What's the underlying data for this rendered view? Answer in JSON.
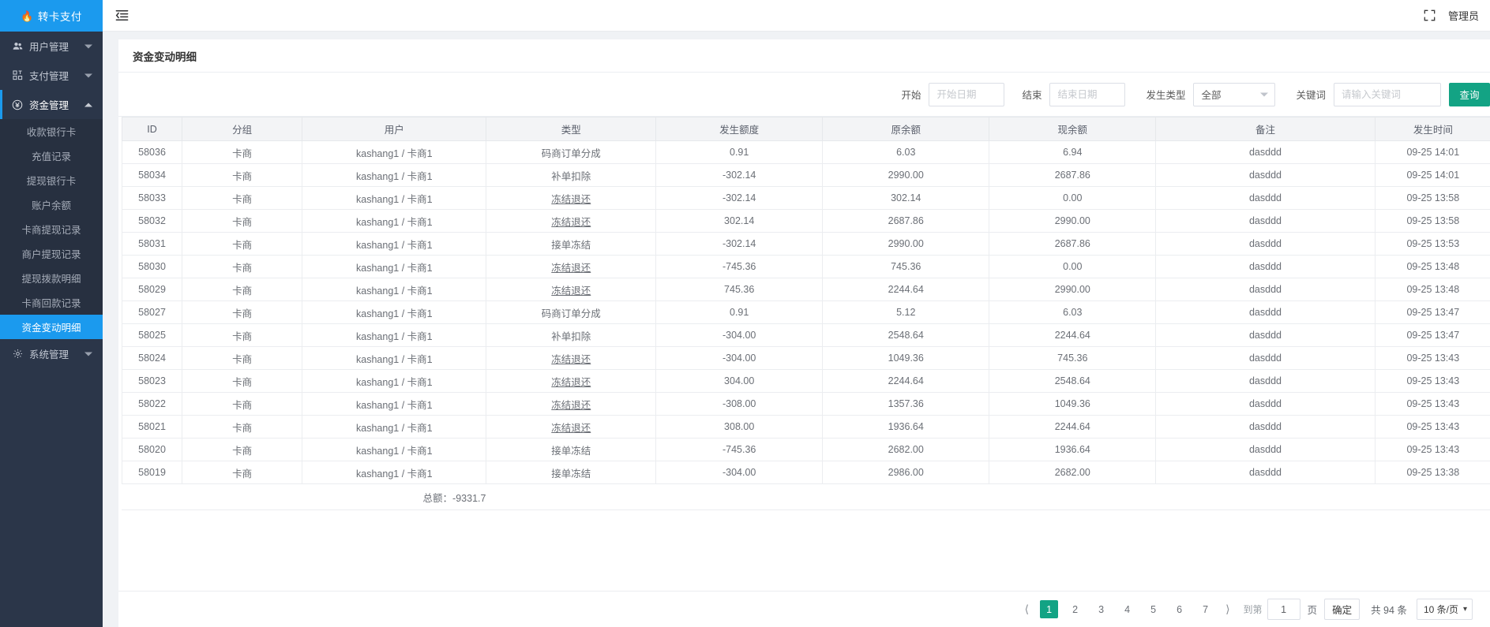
{
  "sidebar": {
    "brand": {
      "label": "转卡支付",
      "icon": "flame-icon",
      "bg": "#1b9aee"
    },
    "groups": [
      {
        "label": "用户管理",
        "icon": "users-icon",
        "expanded": false
      },
      {
        "label": "支付管理",
        "icon": "apps-icon",
        "expanded": false
      },
      {
        "label": "资金管理",
        "icon": "yen-circle-icon",
        "expanded": true
      },
      {
        "label": "系统管理",
        "icon": "gear-icon",
        "expanded": false
      }
    ],
    "fund_submenu": [
      {
        "label": "收款银行卡",
        "selected": false
      },
      {
        "label": "充值记录",
        "selected": false
      },
      {
        "label": "提现银行卡",
        "selected": false
      },
      {
        "label": "账户余额",
        "selected": false
      },
      {
        "label": "卡商提现记录",
        "selected": false
      },
      {
        "label": "商户提现记录",
        "selected": false
      },
      {
        "label": "提现拨款明细",
        "selected": false
      },
      {
        "label": "卡商回款记录",
        "selected": false
      },
      {
        "label": "资金变动明细",
        "selected": true
      }
    ]
  },
  "topbar": {
    "collapse_icon": "menu-collapse-icon",
    "fullscreen_icon": "fullscreen-icon",
    "admin_label": "管理员"
  },
  "page": {
    "title": "资金变动明细"
  },
  "filters": {
    "start_label": "开始",
    "start_placeholder": "开始日期",
    "start_value": "",
    "end_label": "结束",
    "end_placeholder": "结束日期",
    "end_value": "",
    "type_label": "发生类型",
    "type_value": "全部",
    "keyword_label": "关键词",
    "keyword_placeholder": "请输入关键词",
    "keyword_value": "",
    "query_button": "查询",
    "query_color": "#13a384"
  },
  "table": {
    "columns": [
      "ID",
      "分组",
      "用户",
      "类型",
      "发生额度",
      "原余额",
      "现余额",
      "备注",
      "发生时间"
    ],
    "rows": [
      {
        "id": "58036",
        "group": "卡商",
        "user": "kashang1 / 卡商1",
        "type": "码商订单分成",
        "type_link": false,
        "amount": "0.91",
        "old_balance": "6.03",
        "new_balance": "6.94",
        "remark": "dasddd",
        "time": "09-25 14:01"
      },
      {
        "id": "58034",
        "group": "卡商",
        "user": "kashang1 / 卡商1",
        "type": "补单扣除",
        "type_link": false,
        "amount": "-302.14",
        "old_balance": "2990.00",
        "new_balance": "2687.86",
        "remark": "dasddd",
        "time": "09-25 14:01"
      },
      {
        "id": "58033",
        "group": "卡商",
        "user": "kashang1 / 卡商1",
        "type": "冻结退还",
        "type_link": true,
        "amount": "-302.14",
        "old_balance": "302.14",
        "new_balance": "0.00",
        "remark": "dasddd",
        "time": "09-25 13:58"
      },
      {
        "id": "58032",
        "group": "卡商",
        "user": "kashang1 / 卡商1",
        "type": "冻结退还",
        "type_link": true,
        "amount": "302.14",
        "old_balance": "2687.86",
        "new_balance": "2990.00",
        "remark": "dasddd",
        "time": "09-25 13:58"
      },
      {
        "id": "58031",
        "group": "卡商",
        "user": "kashang1 / 卡商1",
        "type": "接单冻结",
        "type_link": false,
        "amount": "-302.14",
        "old_balance": "2990.00",
        "new_balance": "2687.86",
        "remark": "dasddd",
        "time": "09-25 13:53"
      },
      {
        "id": "58030",
        "group": "卡商",
        "user": "kashang1 / 卡商1",
        "type": "冻结退还",
        "type_link": true,
        "amount": "-745.36",
        "old_balance": "745.36",
        "new_balance": "0.00",
        "remark": "dasddd",
        "time": "09-25 13:48"
      },
      {
        "id": "58029",
        "group": "卡商",
        "user": "kashang1 / 卡商1",
        "type": "冻结退还",
        "type_link": true,
        "amount": "745.36",
        "old_balance": "2244.64",
        "new_balance": "2990.00",
        "remark": "dasddd",
        "time": "09-25 13:48"
      },
      {
        "id": "58027",
        "group": "卡商",
        "user": "kashang1 / 卡商1",
        "type": "码商订单分成",
        "type_link": false,
        "amount": "0.91",
        "old_balance": "5.12",
        "new_balance": "6.03",
        "remark": "dasddd",
        "time": "09-25 13:47"
      },
      {
        "id": "58025",
        "group": "卡商",
        "user": "kashang1 / 卡商1",
        "type": "补单扣除",
        "type_link": false,
        "amount": "-304.00",
        "old_balance": "2548.64",
        "new_balance": "2244.64",
        "remark": "dasddd",
        "time": "09-25 13:47"
      },
      {
        "id": "58024",
        "group": "卡商",
        "user": "kashang1 / 卡商1",
        "type": "冻结退还",
        "type_link": true,
        "amount": "-304.00",
        "old_balance": "1049.36",
        "new_balance": "745.36",
        "remark": "dasddd",
        "time": "09-25 13:43"
      },
      {
        "id": "58023",
        "group": "卡商",
        "user": "kashang1 / 卡商1",
        "type": "冻结退还",
        "type_link": true,
        "amount": "304.00",
        "old_balance": "2244.64",
        "new_balance": "2548.64",
        "remark": "dasddd",
        "time": "09-25 13:43"
      },
      {
        "id": "58022",
        "group": "卡商",
        "user": "kashang1 / 卡商1",
        "type": "冻结退还",
        "type_link": true,
        "amount": "-308.00",
        "old_balance": "1357.36",
        "new_balance": "1049.36",
        "remark": "dasddd",
        "time": "09-25 13:43"
      },
      {
        "id": "58021",
        "group": "卡商",
        "user": "kashang1 / 卡商1",
        "type": "冻结退还",
        "type_link": true,
        "amount": "308.00",
        "old_balance": "1936.64",
        "new_balance": "2244.64",
        "remark": "dasddd",
        "time": "09-25 13:43"
      },
      {
        "id": "58020",
        "group": "卡商",
        "user": "kashang1 / 卡商1",
        "type": "接单冻结",
        "type_link": false,
        "amount": "-745.36",
        "old_balance": "2682.00",
        "new_balance": "1936.64",
        "remark": "dasddd",
        "time": "09-25 13:43"
      },
      {
        "id": "58019",
        "group": "卡商",
        "user": "kashang1 / 卡商1",
        "type": "接单冻结",
        "type_link": false,
        "amount": "-304.00",
        "old_balance": "2986.00",
        "new_balance": "2682.00",
        "remark": "dasddd",
        "time": "09-25 13:38"
      }
    ],
    "total_label": "总额：-9331.7"
  },
  "pagination": {
    "prev_icon": "chevron-left-icon",
    "next_icon": "chevron-right-icon",
    "pages": [
      "1",
      "2",
      "3",
      "4",
      "5",
      "6",
      "7"
    ],
    "current_page": "1",
    "jump_label": "到第",
    "jump_value": "1",
    "page_unit": "页",
    "confirm_label": "确定",
    "total_label": "共 94 条",
    "page_size_label": "10 条/页"
  }
}
